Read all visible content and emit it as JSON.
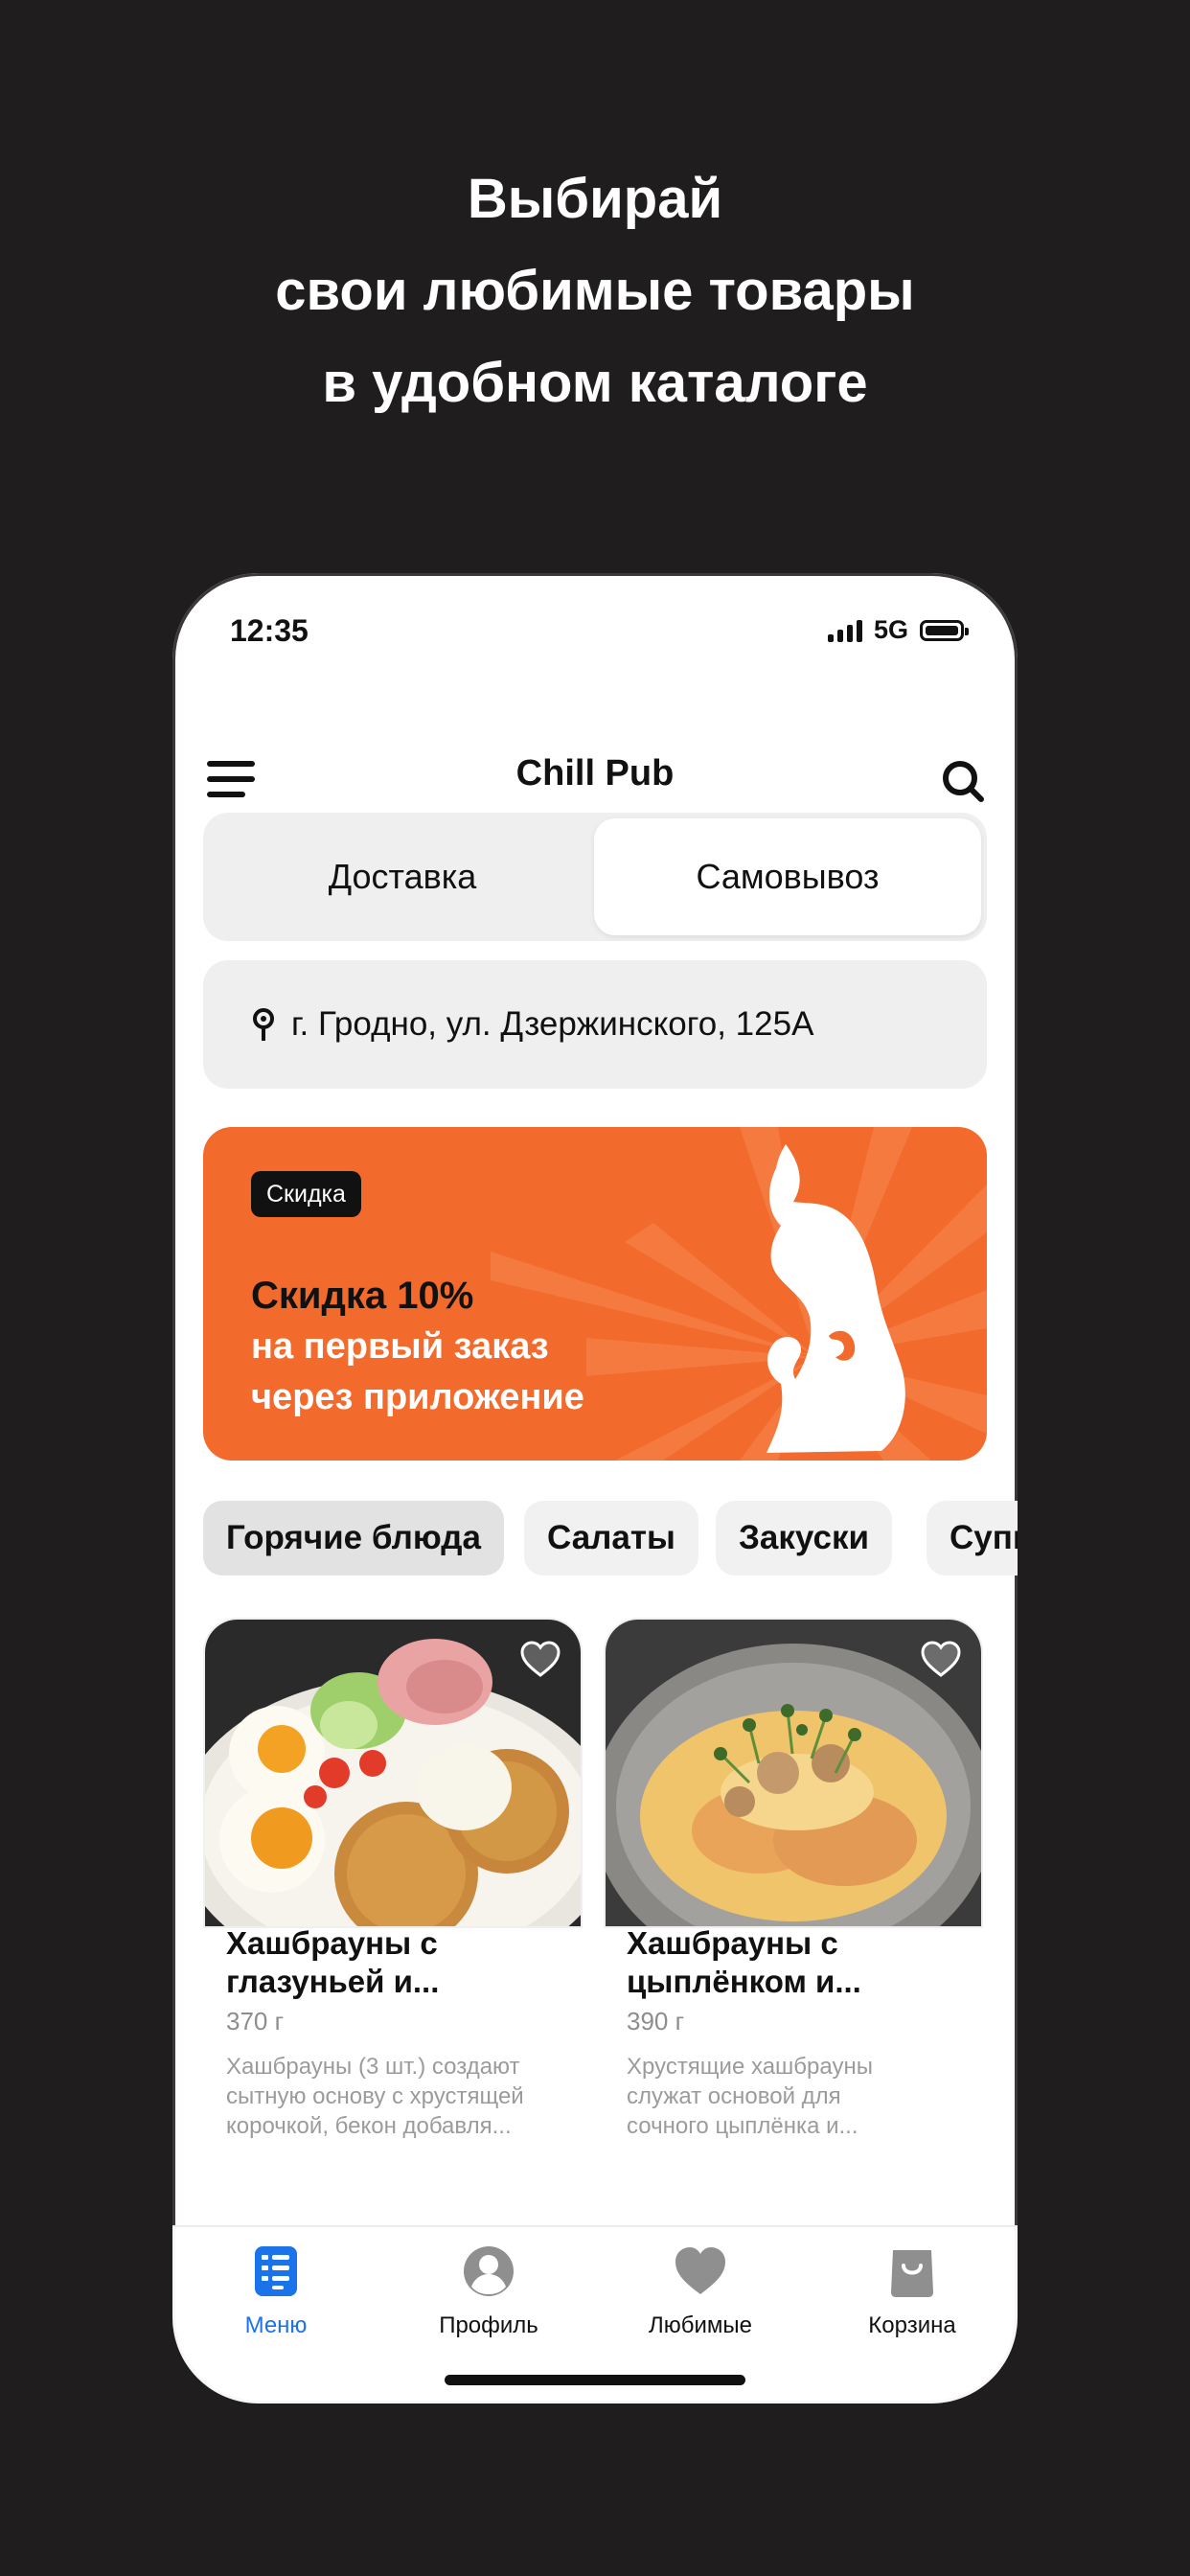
{
  "headline": [
    "Выбирай",
    "свои любимые товары",
    "в удобном каталоге"
  ],
  "status": {
    "time": "12:35",
    "network": "5G"
  },
  "app": {
    "title": "Chill Pub"
  },
  "delivery_toggle": {
    "options": [
      "Доставка",
      "Самовывоз"
    ],
    "selected": "Самовывоз"
  },
  "address": "г. Гродно, ул. Дзержинского, 125А",
  "promo": {
    "tag": "Скидка",
    "line1": "Скидка 10%",
    "line2": "на первый заказ",
    "line3": "через приложение",
    "color": "#f26a2c"
  },
  "categories": [
    "Горячие блюда",
    "Салаты",
    "Закуски",
    "Супы"
  ],
  "active_category": "Горячие блюда",
  "products": [
    {
      "title_line1": "Хашбрауны с",
      "title_line2": "глазуньей и...",
      "weight": "370 г",
      "desc_line1": "Хашбрауны (3 шт.) создают",
      "desc_line2": "сытную основу с хрустящей",
      "desc_line3": "корочкой, бекон добавля..."
    },
    {
      "title_line1": "Хашбрауны с",
      "title_line2": "цыплёнком и...",
      "weight": "390 г",
      "desc_line1": "Хрустящие хашбрауны",
      "desc_line2": "служат основой для",
      "desc_line3": "сочного цыплёнка и..."
    }
  ],
  "tabs": [
    {
      "label": "Меню",
      "icon": "menu-list-icon"
    },
    {
      "label": "Профиль",
      "icon": "profile-icon"
    },
    {
      "label": "Любимые",
      "icon": "heart-icon"
    },
    {
      "label": "Корзина",
      "icon": "cart-bag-icon"
    }
  ],
  "active_tab": "Меню",
  "accent_color": "#1a73e8"
}
